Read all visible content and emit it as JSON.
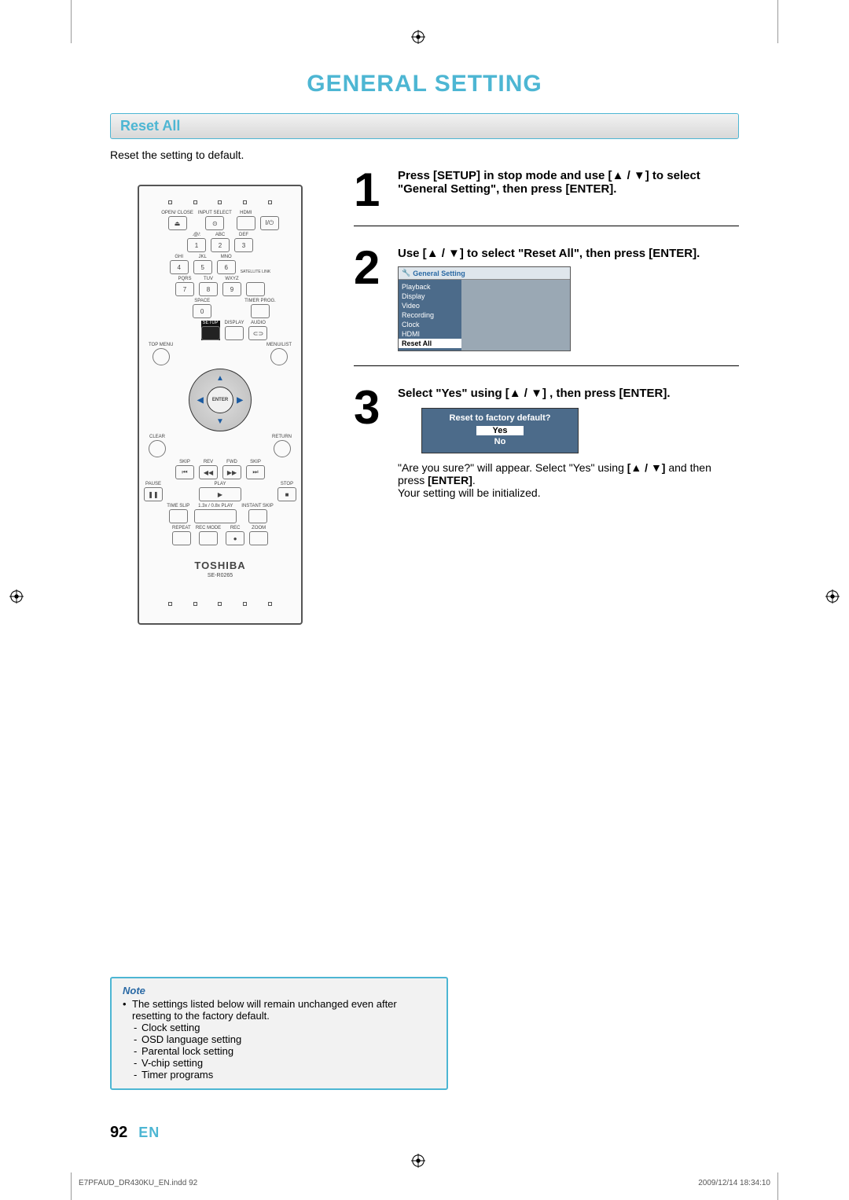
{
  "page_title": "GENERAL SETTING",
  "section_title": "Reset All",
  "intro_text": "Reset the setting to default.",
  "remote": {
    "row1": [
      "OPEN/\nCLOSE",
      "INPUT\nSELECT",
      "HDMI",
      ""
    ],
    "row1_sym": [
      "⏏",
      "⊙",
      "",
      "I/⏻"
    ],
    "numpad_labels": [
      ".@/:",
      "ABC",
      "DEF",
      "GHI",
      "JKL",
      "MNO",
      "PQRS",
      "TUV",
      "WXYZ"
    ],
    "numpad_digits": [
      "1",
      "2",
      "3",
      "4",
      "5",
      "6",
      "7",
      "8",
      "9"
    ],
    "satellite": "SATELLITE\nLINK",
    "space": "SPACE",
    "zero": "0",
    "timer": "TIMER\nPROG.",
    "setup": "SETUP",
    "display": "DISPLAY",
    "audio": "AUDIO",
    "audio_sym": "⊂⊃",
    "topmenu": "TOP MENU",
    "menulist": "MENU/LIST",
    "enter": "ENTER",
    "clear": "CLEAR",
    "return_lbl": "RETURN",
    "transport_labels": [
      "SKIP",
      "REV",
      "FWD",
      "SKIP"
    ],
    "transport_syms": [
      "⏮",
      "◀◀",
      "▶▶",
      "⏭"
    ],
    "pprow_labels": [
      "PAUSE",
      "PLAY",
      "STOP"
    ],
    "pprow_syms": [
      "❚❚",
      "▶",
      "■"
    ],
    "timeslip_row": [
      "TIME SLIP",
      "1.3x / 0.8x PLAY",
      "INSTANT SKIP"
    ],
    "bottom_row": [
      "REPEAT",
      "REC MODE",
      "REC",
      "ZOOM"
    ],
    "brand": "TOSHIBA",
    "model": "SE-R0265"
  },
  "steps": [
    {
      "num": "1",
      "title_a": "Press [SETUP] in stop mode and use [",
      "title_sym": "▲ / ▼",
      "title_b": "] to select \"General Setting\", then press [ENTER]."
    },
    {
      "num": "2",
      "title_a": "Use [",
      "title_sym": "▲ / ▼",
      "title_b": "] to select \"Reset All\", then press [ENTER].",
      "osd_title": "General Setting",
      "osd_items": [
        "Playback",
        "Display",
        "Video",
        "Recording",
        "Clock",
        "HDMI",
        "Reset All"
      ],
      "osd_selected": 6
    },
    {
      "num": "3",
      "title_a": "Select \"Yes\" using [",
      "title_sym": "▲ / ▼",
      "title_b": "] , then press [ENTER].",
      "dialog_q": "Reset to factory default?",
      "dialog_yes": "Yes",
      "dialog_no": "No",
      "sub_a": "\"Are you sure?\" will appear. Select \"Yes\" using ",
      "sub_sym": "[▲ / ▼]",
      "sub_b": " and then press ",
      "sub_enter": "[ENTER]",
      "sub_c": ".",
      "sub2": "Your setting will be initialized."
    }
  ],
  "note": {
    "title": "Note",
    "bullet": "The settings listed below will remain unchanged even after resetting to the factory default.",
    "items": [
      "Clock setting",
      "OSD language setting",
      "Parental lock setting",
      "V-chip setting",
      "Timer programs"
    ]
  },
  "foot": {
    "page": "92",
    "lang": "EN"
  },
  "footer_meta": {
    "left": "E7PFAUD_DR430KU_EN.indd   92",
    "right": "2009/12/14   18:34:10"
  }
}
